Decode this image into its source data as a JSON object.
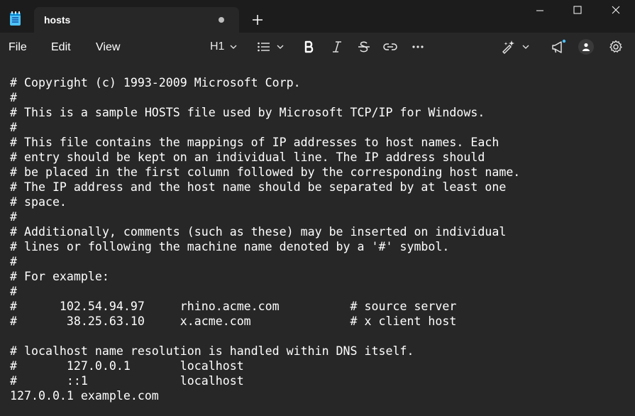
{
  "window": {
    "tab_title": "hosts",
    "icons": {
      "app": "notepad-icon",
      "new_tab": "plus-icon",
      "minimize": "minimize-icon",
      "maximize": "maximize-icon",
      "close": "close-icon"
    }
  },
  "menu": {
    "file": "File",
    "edit": "Edit",
    "view": "View"
  },
  "toolbar": {
    "heading_label": "H1",
    "icons": [
      "chevron-down-icon",
      "bulleted-list-icon",
      "bold-icon",
      "italic-icon",
      "strikethrough-icon",
      "link-icon",
      "more-icon",
      "copilot-icon",
      "announcement-icon",
      "account-icon",
      "settings-icon"
    ]
  },
  "colors": {
    "titlebar": "#1c1c1c",
    "background": "#272727",
    "text": "#ffffff",
    "notification": "#4cc2ff"
  },
  "editor": {
    "lines": [
      "# Copyright (c) 1993-2009 Microsoft Corp.",
      "#",
      "# This is a sample HOSTS file used by Microsoft TCP/IP for Windows.",
      "#",
      "# This file contains the mappings of IP addresses to host names. Each",
      "# entry should be kept on an individual line. The IP address should",
      "# be placed in the first column followed by the corresponding host name.",
      "# The IP address and the host name should be separated by at least one",
      "# space.",
      "#",
      "# Additionally, comments (such as these) may be inserted on individual",
      "# lines or following the machine name denoted by a '#' symbol.",
      "#",
      "# For example:",
      "#",
      "#      102.54.94.97     rhino.acme.com          # source server",
      "#       38.25.63.10     x.acme.com              # x client host",
      "",
      "# localhost name resolution is handled within DNS itself.",
      "#       127.0.0.1       localhost",
      "#       ::1             localhost",
      "127.0.0.1 example.com"
    ]
  }
}
